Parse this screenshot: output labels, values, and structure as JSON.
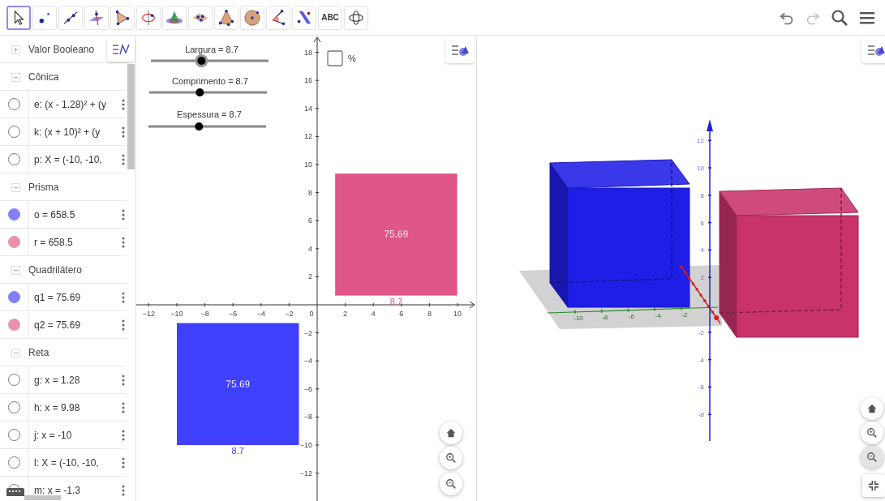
{
  "toolbar": {
    "tools": [
      {
        "kind": "move",
        "selected": true
      },
      {
        "kind": "point",
        "selected": false
      },
      {
        "kind": "line",
        "selected": false
      },
      {
        "kind": "perpendicular",
        "selected": false
      },
      {
        "kind": "polygon",
        "selected": false
      },
      {
        "kind": "rotate-around-line",
        "selected": false
      },
      {
        "kind": "cone",
        "selected": false
      },
      {
        "kind": "plane",
        "selected": false
      },
      {
        "kind": "pyramid",
        "selected": false
      },
      {
        "kind": "sphere",
        "selected": false
      },
      {
        "kind": "angle",
        "selected": false
      },
      {
        "kind": "reflect",
        "selected": false
      },
      {
        "kind": "text",
        "label": "ABC",
        "selected": false
      },
      {
        "kind": "rotate-view",
        "selected": false
      }
    ],
    "undo": {
      "disabled": false
    },
    "redo": {
      "disabled": true
    }
  },
  "algebra": {
    "groups": [
      {
        "title": "Valor Booleano",
        "expanded": false
      },
      {
        "title": "Cônica",
        "expanded": true,
        "items": [
          {
            "text": "e: (x - 1.28)² + (y",
            "visible": false
          },
          {
            "text": "k: (x + 10)² + (y",
            "visible": false
          },
          {
            "text": "p: X = (-10, -10,",
            "visible": false
          }
        ]
      },
      {
        "title": "Prisma",
        "expanded": true,
        "items": [
          {
            "text": "o = 658.5",
            "visible": true,
            "color": "#8080f8"
          },
          {
            "text": "r = 658.5",
            "visible": true,
            "color": "#e892aa"
          }
        ]
      },
      {
        "title": "Quadrilátero",
        "expanded": true,
        "items": [
          {
            "text": "q1 = 75.69",
            "visible": true,
            "color": "#8080f8"
          },
          {
            "text": "q2 = 75.69",
            "visible": true,
            "color": "#e892aa"
          }
        ]
      },
      {
        "title": "Reta",
        "expanded": true,
        "items": [
          {
            "text": "g: x = 1.28",
            "visible": false
          },
          {
            "text": "h: x = 9.98",
            "visible": false
          },
          {
            "text": "j: x = -10",
            "visible": false
          },
          {
            "text": "l: X = (-10, -10,",
            "visible": false
          },
          {
            "text": "m: x = -1.3",
            "visible": false
          }
        ]
      }
    ]
  },
  "graphics_2d": {
    "sliders": [
      {
        "label": "Largura = 8.7",
        "level": 0.43,
        "selected": true
      },
      {
        "label": "Comprimento = 8.7",
        "level": 0.43,
        "selected": false
      },
      {
        "label": "Espessura = 8.7",
        "level": 0.43,
        "selected": false
      }
    ],
    "checkbox": {
      "label": "%",
      "checked": false
    },
    "x_tick_labels": [
      "−12",
      "−10",
      "−8",
      "−6",
      "−4",
      "−2",
      "0",
      "2",
      "4",
      "6",
      "8",
      "10"
    ],
    "y_tick_labels": [
      "18",
      "16",
      "14",
      "12",
      "10",
      "8",
      "6",
      "4",
      "2",
      "−2",
      "−4",
      "−6",
      "−8",
      "−10",
      "−12"
    ],
    "squares": [
      {
        "color": "#e0558a",
        "area_label": "75.69",
        "side_label": "8.7"
      },
      {
        "color": "#4040ff",
        "area_label": "75.69",
        "side_label": "8.7"
      }
    ]
  },
  "graphics_3d": {
    "z_tick_labels": [
      "12",
      "10",
      "8",
      "6",
      "4",
      "2",
      "-2",
      "-4",
      "-6",
      "-8"
    ],
    "y_tick_labels": [
      "-10",
      "-8",
      "-6",
      "-4",
      "-2"
    ],
    "solids": [
      {
        "color": "#1e1ee6"
      },
      {
        "color": "#c8336c"
      }
    ]
  }
}
